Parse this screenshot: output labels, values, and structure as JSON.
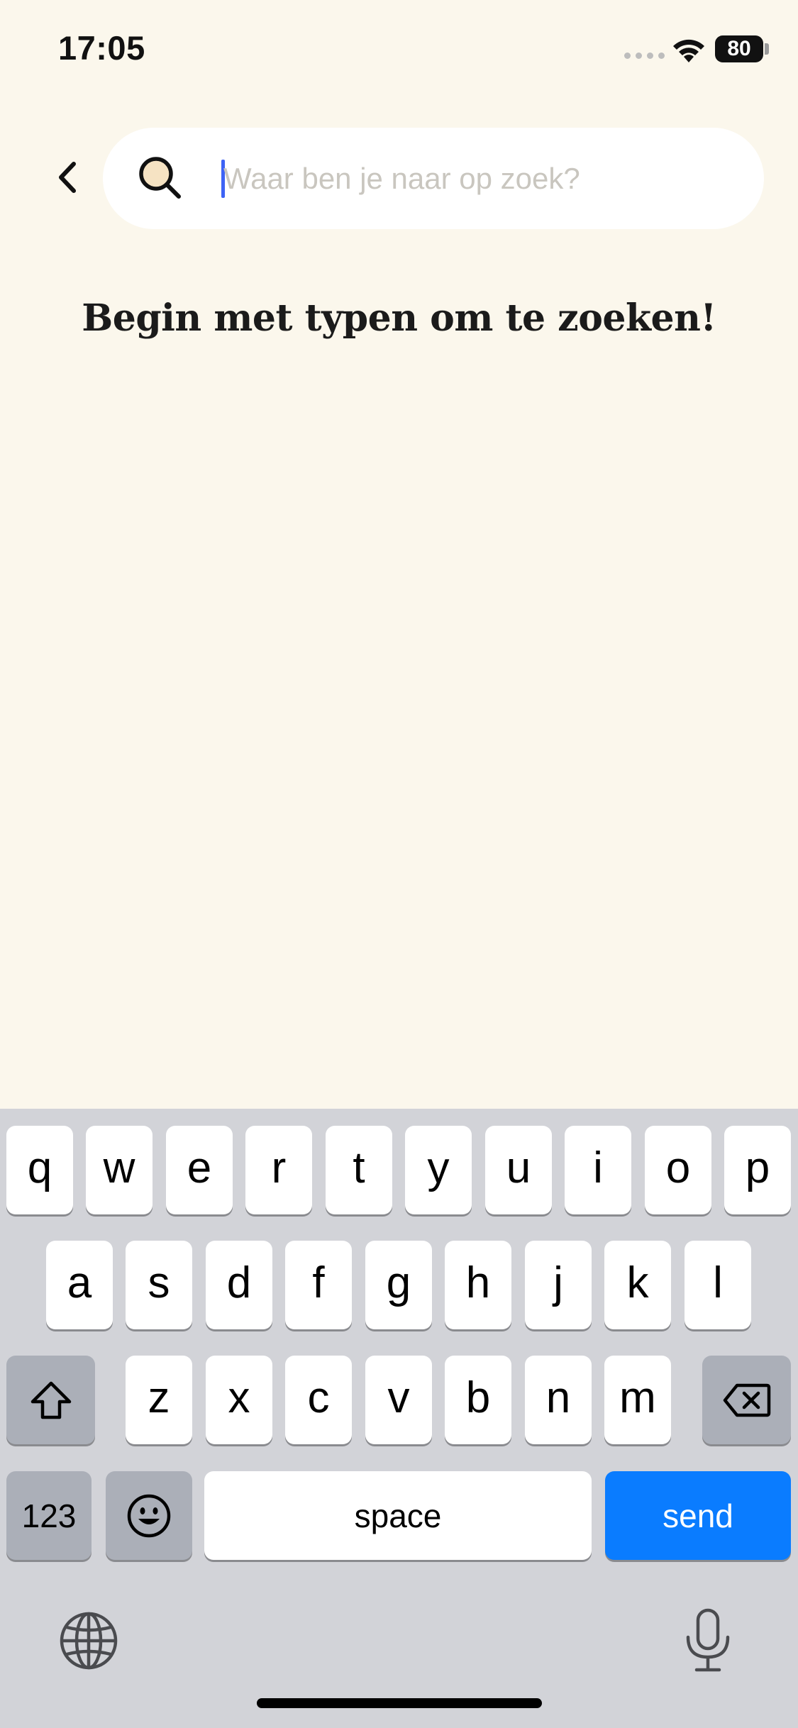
{
  "status_bar": {
    "time": "17:05",
    "battery_level": "80"
  },
  "search": {
    "placeholder": "Waar ben je naar op zoek?",
    "value": ""
  },
  "empty_state": {
    "message": "Begin met typen om te zoeken!"
  },
  "keyboard": {
    "row1": [
      "q",
      "w",
      "e",
      "r",
      "t",
      "y",
      "u",
      "i",
      "o",
      "p"
    ],
    "row2": [
      "a",
      "s",
      "d",
      "f",
      "g",
      "h",
      "j",
      "k",
      "l"
    ],
    "row3": [
      "z",
      "x",
      "c",
      "v",
      "b",
      "n",
      "m"
    ],
    "numbers_label": "123",
    "space_label": "space",
    "send_label": "send"
  },
  "colors": {
    "background": "#FBF7EC",
    "caret": "#3E63F5",
    "send_key": "#0A7CFF",
    "keyboard_bg": "#D2D3D8"
  },
  "icons": [
    "chevron-left-icon",
    "search-icon",
    "wifi-icon",
    "shift-icon",
    "backspace-icon",
    "emoji-icon",
    "globe-icon",
    "microphone-icon"
  ]
}
